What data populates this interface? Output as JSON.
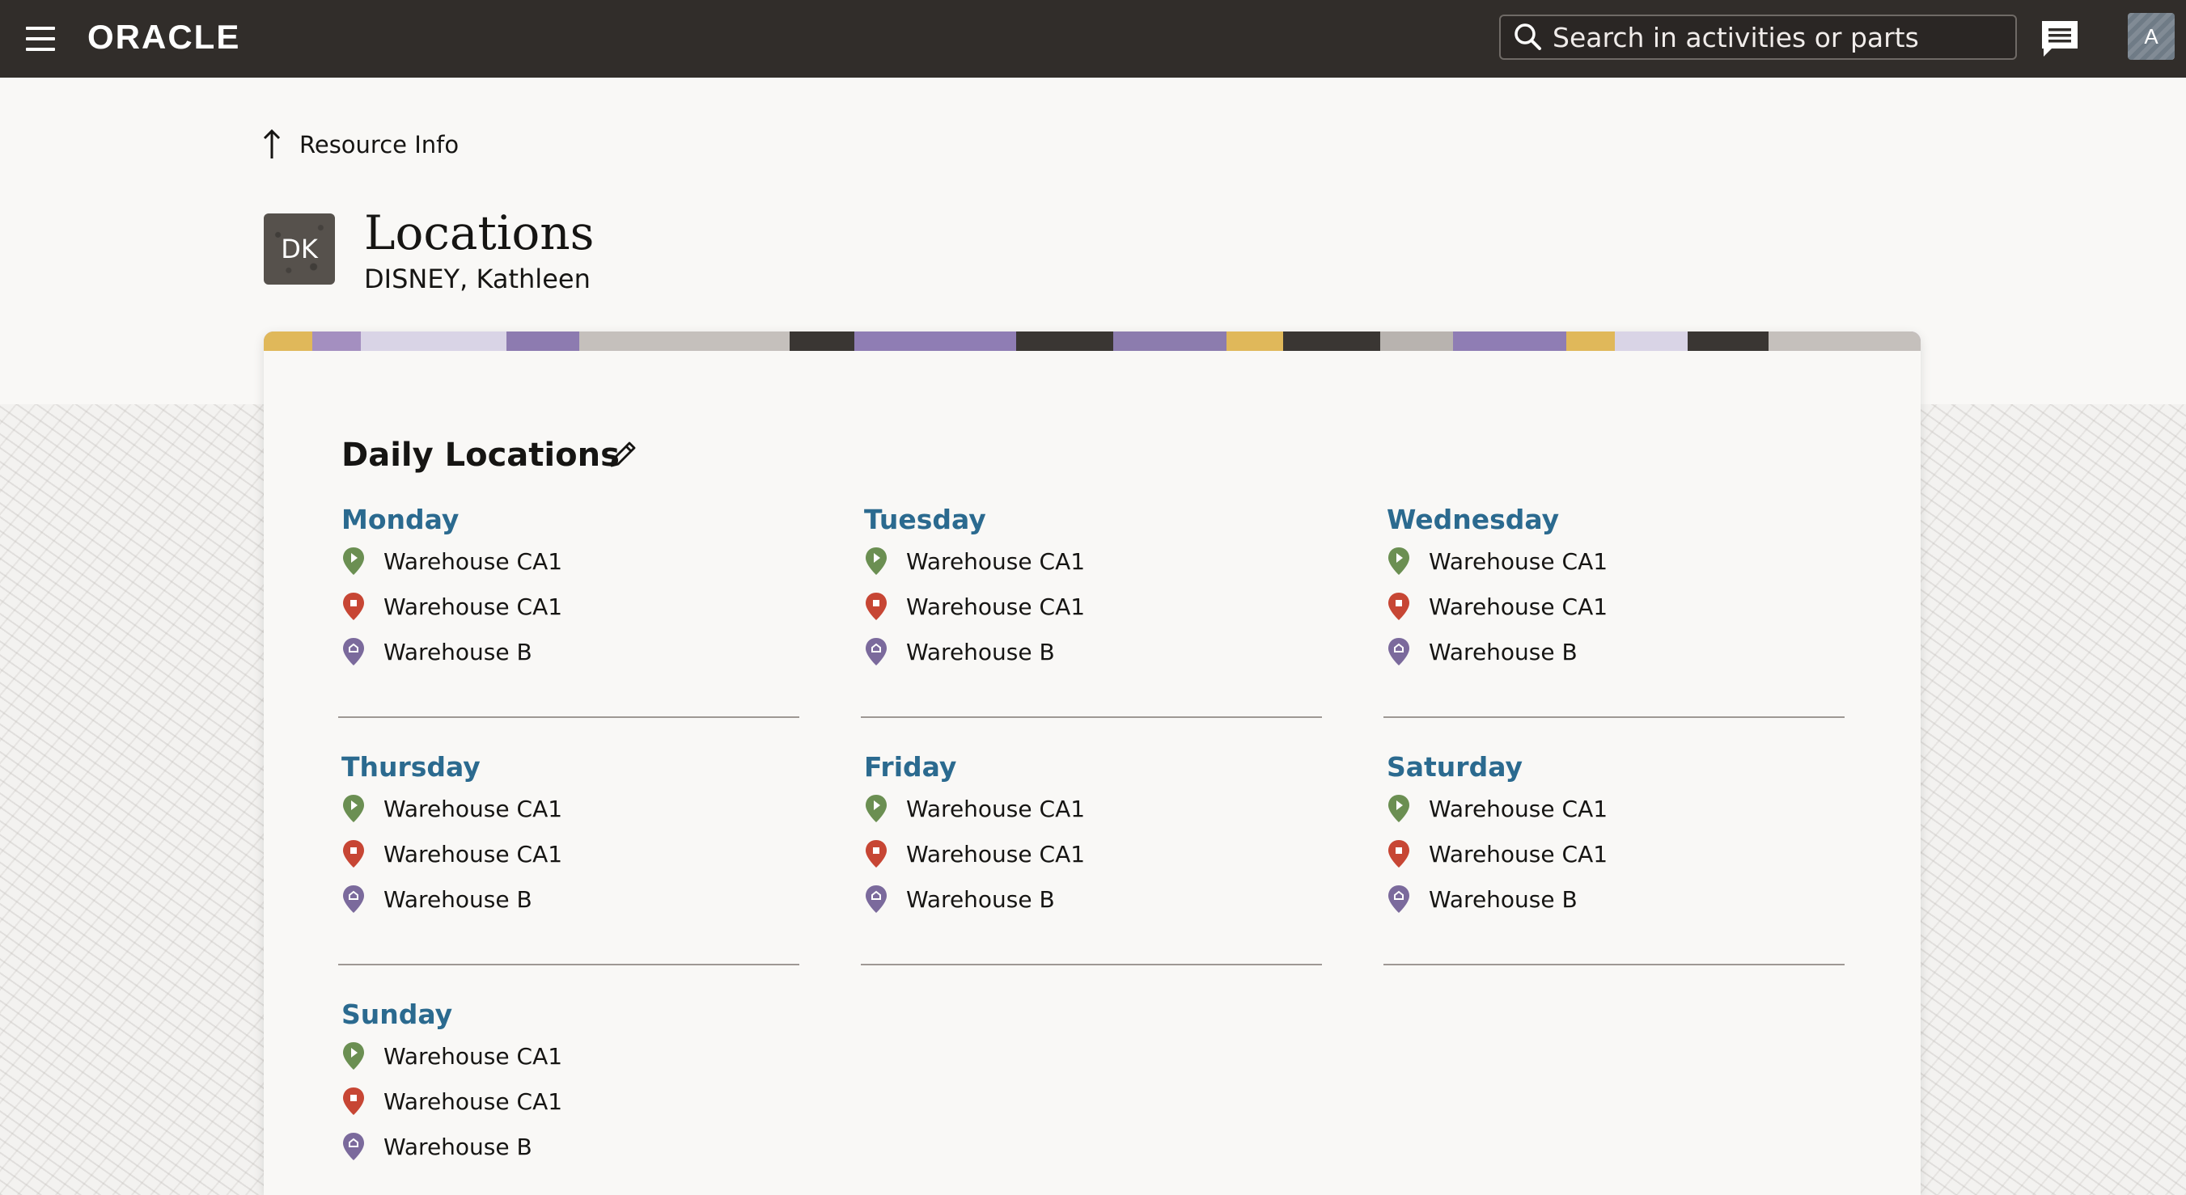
{
  "header": {
    "logo_text": "ORACLE",
    "search_placeholder": "Search in activities or parts",
    "user_initial": "A"
  },
  "nav": {
    "back_label": "Resource Info"
  },
  "resource": {
    "initials": "DK",
    "title": "Locations",
    "name": "DISNEY, Kathleen"
  },
  "card": {
    "section_title": "Daily Locations"
  },
  "days": [
    {
      "name": "Monday",
      "start": "Warehouse CA1",
      "end": "Warehouse CA1",
      "home": "Warehouse B"
    },
    {
      "name": "Tuesday",
      "start": "Warehouse CA1",
      "end": "Warehouse CA1",
      "home": "Warehouse B"
    },
    {
      "name": "Wednesday",
      "start": "Warehouse CA1",
      "end": "Warehouse CA1",
      "home": "Warehouse B"
    },
    {
      "name": "Thursday",
      "start": "Warehouse CA1",
      "end": "Warehouse CA1",
      "home": "Warehouse B"
    },
    {
      "name": "Friday",
      "start": "Warehouse CA1",
      "end": "Warehouse CA1",
      "home": "Warehouse B"
    },
    {
      "name": "Saturday",
      "start": "Warehouse CA1",
      "end": "Warehouse CA1",
      "home": "Warehouse B"
    },
    {
      "name": "Sunday",
      "start": "Warehouse CA1",
      "end": "Warehouse CA1",
      "home": "Warehouse B"
    }
  ],
  "colors": {
    "topbar": "#312d2a",
    "day_name": "#2b6a8f",
    "start_pin": "#6b8f52",
    "end_pin": "#c74634",
    "home_pin": "#7b6a9c"
  }
}
